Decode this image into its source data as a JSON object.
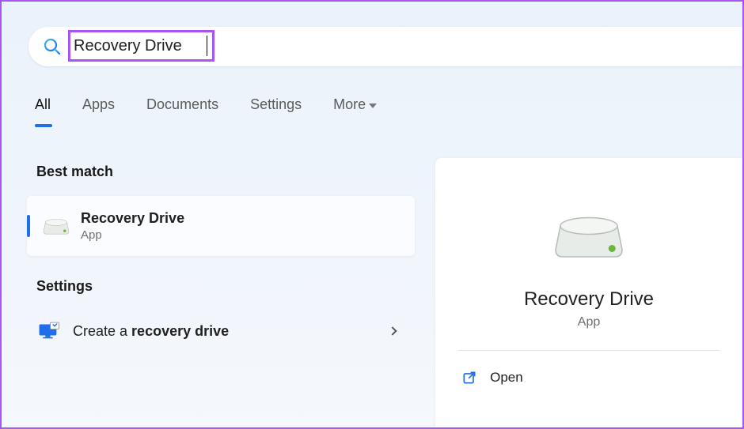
{
  "search": {
    "query": "Recovery Drive"
  },
  "tabs": {
    "all": "All",
    "apps": "Apps",
    "documents": "Documents",
    "settings": "Settings",
    "more": "More"
  },
  "sections": {
    "best_match": "Best match",
    "settings": "Settings"
  },
  "best_result": {
    "title": "Recovery Drive",
    "type": "App"
  },
  "settings_item": {
    "prefix": "Create a ",
    "bold": "recovery drive"
  },
  "detail": {
    "title": "Recovery Drive",
    "type": "App",
    "open": "Open"
  },
  "colors": {
    "accent": "#1f6feb",
    "highlight": "#a855f7"
  }
}
